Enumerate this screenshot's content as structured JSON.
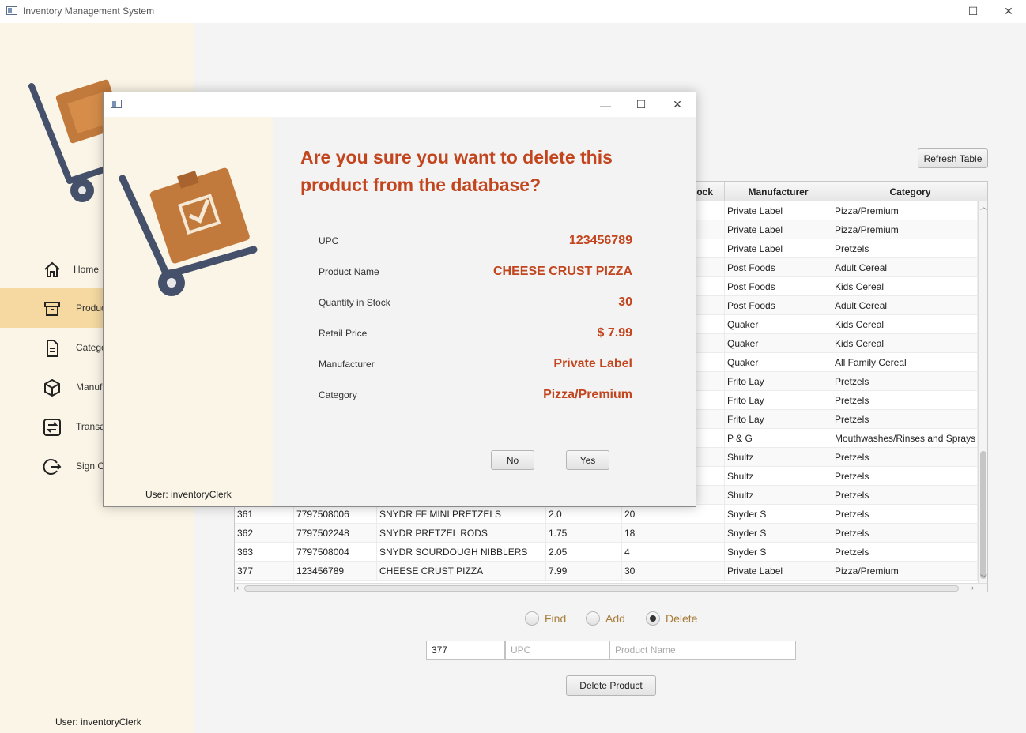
{
  "window": {
    "title": "Inventory Management System",
    "minimize": "—",
    "maximize": "☐",
    "close": "✕"
  },
  "sidebar": {
    "items": [
      {
        "label": "Home",
        "icon": "home-icon"
      },
      {
        "label": "Produc",
        "icon": "archive-box-icon"
      },
      {
        "label": "Catego",
        "icon": "document-icon"
      },
      {
        "label": "Manuf",
        "icon": "cube-icon"
      },
      {
        "label": "Transa",
        "icon": "transfer-icon"
      },
      {
        "label": "Sign O",
        "icon": "sign-out-icon"
      }
    ],
    "user": "User: inventoryClerk"
  },
  "toolbar": {
    "refresh_label": "Refresh Table"
  },
  "table": {
    "headers": [
      "",
      "",
      "",
      "",
      "ock",
      "Manufacturer",
      "Category"
    ],
    "rows": [
      [
        "",
        "",
        "",
        "",
        "",
        "Private Label",
        "Pizza/Premium"
      ],
      [
        "",
        "",
        "",
        "",
        "",
        "Private Label",
        "Pizza/Premium"
      ],
      [
        "",
        "",
        "",
        "",
        "",
        "Private Label",
        "Pretzels"
      ],
      [
        "",
        "",
        "",
        "",
        "",
        "Post Foods",
        "Adult Cereal"
      ],
      [
        "",
        "",
        "",
        "",
        "",
        "Post Foods",
        "Kids Cereal"
      ],
      [
        "",
        "",
        "",
        "",
        "",
        "Post Foods",
        "Adult Cereal"
      ],
      [
        "",
        "",
        "",
        "",
        "",
        "Quaker",
        "Kids Cereal"
      ],
      [
        "",
        "",
        "",
        "",
        "",
        "Quaker",
        "Kids Cereal"
      ],
      [
        "",
        "",
        "",
        "",
        "",
        "Quaker",
        "All Family Cereal"
      ],
      [
        "",
        "",
        "",
        "",
        "",
        "Frito Lay",
        "Pretzels"
      ],
      [
        "",
        "",
        "",
        "",
        "",
        "Frito Lay",
        "Pretzels"
      ],
      [
        "",
        "",
        "",
        "",
        "",
        "Frito Lay",
        "Pretzels"
      ],
      [
        "",
        "",
        "",
        "",
        "",
        "P & G",
        "Mouthwashes/Rinses and Sprays"
      ],
      [
        "",
        "",
        "",
        "",
        "",
        "Shultz",
        "Pretzels"
      ],
      [
        "",
        "",
        "",
        "",
        "",
        "Shultz",
        "Pretzels"
      ],
      [
        "",
        "",
        "",
        "",
        "",
        "Shultz",
        "Pretzels"
      ],
      [
        "361",
        "7797508006",
        "SNYDR FF MINI PRETZELS",
        "2.0",
        "20",
        "Snyder S",
        "Pretzels"
      ],
      [
        "362",
        "7797502248",
        "SNYDR PRETZEL RODS",
        "1.75",
        "18",
        "Snyder S",
        "Pretzels"
      ],
      [
        "363",
        "7797508004",
        "SNYDR SOURDOUGH NIBBLERS",
        "2.05",
        "4",
        "Snyder S",
        "Pretzels"
      ],
      [
        "377",
        "123456789",
        "CHEESE CRUST PIZZA",
        "7.99",
        "30",
        "Private Label",
        "Pizza/Premium"
      ]
    ]
  },
  "mode": {
    "options": [
      "Find",
      "Add",
      "Delete"
    ],
    "selected": "Delete"
  },
  "inputs": {
    "id_value": "377",
    "upc_placeholder": "UPC",
    "name_placeholder": "Product Name"
  },
  "action": {
    "delete_label": "Delete Product"
  },
  "dialog": {
    "heading": "Are you sure you want to delete this product from the database?",
    "user": "User: inventoryClerk",
    "fields": [
      {
        "label": "UPC",
        "value": "123456789"
      },
      {
        "label": "Product Name",
        "value": "CHEESE CRUST PIZZA"
      },
      {
        "label": "Quantity in Stock",
        "value": "30"
      },
      {
        "label": "Retail Price",
        "value": "$ 7.99"
      },
      {
        "label": "Manufacturer",
        "value": "Private Label"
      },
      {
        "label": "Category",
        "value": "Pizza/Premium"
      }
    ],
    "no_label": "No",
    "yes_label": "Yes"
  },
  "colors": {
    "accent": "#c2451e",
    "sidebar_bg": "#fbf5e7",
    "sidebar_active": "#f5d9a1",
    "radio_label": "#a77d3a"
  }
}
